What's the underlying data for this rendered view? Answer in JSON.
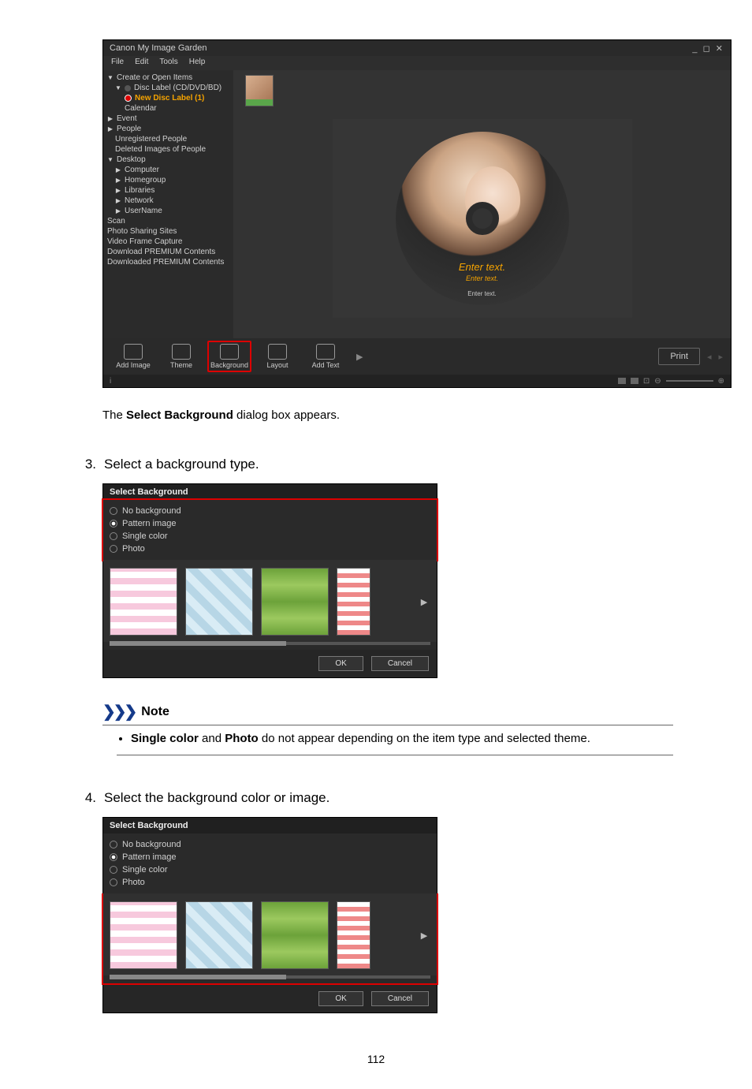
{
  "app": {
    "title": "Canon My Image Garden",
    "menus": [
      "File",
      "Edit",
      "Tools",
      "Help"
    ],
    "tree": {
      "create": "Create or Open Items",
      "disc_label": "Disc Label (CD/DVD/BD)",
      "new_disc": "New Disc Label (1)",
      "calendar": "Calendar",
      "event": "Event",
      "people": "People",
      "unreg": "Unregistered People",
      "deleted": "Deleted Images of People",
      "desktop": "Desktop",
      "computer": "Computer",
      "homegroup": "Homegroup",
      "libraries": "Libraries",
      "network": "Network",
      "username": "UserName",
      "scan": "Scan",
      "sharing": "Photo Sharing Sites",
      "videoframe": "Video Frame Capture",
      "dlpremium": "Download PREMIUM Contents",
      "dledpremium": "Downloaded PREMIUM Contents"
    },
    "disc_text": {
      "t1": "Enter text.",
      "t2": "Enter text.",
      "t3": "Enter text."
    },
    "toolbar": {
      "add_image": "Add Image",
      "theme": "Theme",
      "background": "Background",
      "layout": "Layout",
      "add_text": "Add Text",
      "print": "Print"
    },
    "status_info": "i"
  },
  "para_select_bg_prefix": "The ",
  "para_select_bg_bold": "Select Background",
  "para_select_bg_suffix": " dialog box appears.",
  "step3_num": "3.",
  "step3_text": "Select a background type.",
  "step4_num": "4.",
  "step4_text": "Select the background color or image.",
  "dialog": {
    "title": "Select Background",
    "opts": {
      "no_bg": "No background",
      "pattern": "Pattern image",
      "single": "Single color",
      "photo": "Photo"
    },
    "ok": "OK",
    "cancel": "Cancel"
  },
  "note": {
    "heading": "Note",
    "bullet_b1": "Single color",
    "bullet_mid": " and ",
    "bullet_b2": "Photo",
    "bullet_rest": " do not appear depending on the item type and selected theme."
  },
  "page_number": "112"
}
